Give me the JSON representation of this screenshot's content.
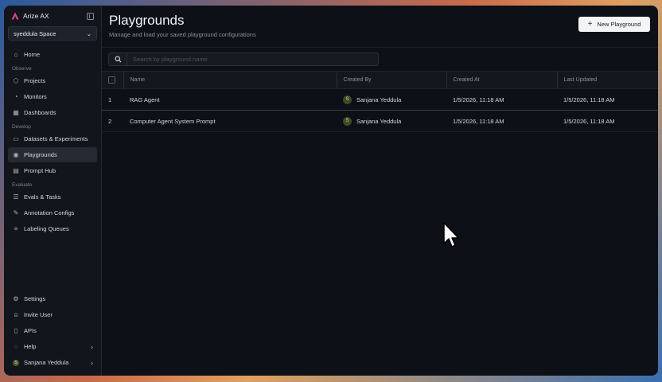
{
  "app": {
    "name": "Arize AX"
  },
  "space": {
    "label": "syeddula Space"
  },
  "sidebar": {
    "home": "Home",
    "observe_label": "Observe",
    "observe_items": [
      "Projects",
      "Monitors",
      "Dashboards"
    ],
    "develop_label": "Develop",
    "develop_items": [
      "Datasets & Experiments",
      "Playgrounds",
      "Prompt Hub"
    ],
    "evaluate_label": "Evaluate",
    "evaluate_items": [
      "Evals & Tasks",
      "Annotation Configs",
      "Labeling Queues"
    ],
    "bottom_items": [
      "Settings",
      "Invite User",
      "APIs",
      "Help"
    ],
    "user": {
      "name": "Sanjana Yeddula",
      "initial": "S"
    }
  },
  "page": {
    "title": "Playgrounds",
    "subtitle": "Manage and load your saved playground configurations",
    "new_button": "New Playground"
  },
  "search": {
    "placeholder": "Search by playground name"
  },
  "table": {
    "columns": [
      "Name",
      "Created By",
      "Created At",
      "Last Updated"
    ],
    "rows": [
      {
        "index": "1",
        "name": "RAG Agent",
        "created_by": "Sanjana Yeddula",
        "initial": "S",
        "created_at": "1/5/2026, 11:18 AM",
        "last_updated": "1/5/2026, 11:18 AM"
      },
      {
        "index": "2",
        "name": "Computer Agent System Prompt",
        "created_by": "Sanjana Yeddula",
        "initial": "S",
        "created_at": "1/5/2026, 11:18 AM",
        "last_updated": "1/5/2026, 11:18 AM"
      }
    ]
  },
  "colors": {
    "accent_logo": "#e0457b",
    "background": "#0d1017",
    "sidebar": "#12151c"
  }
}
